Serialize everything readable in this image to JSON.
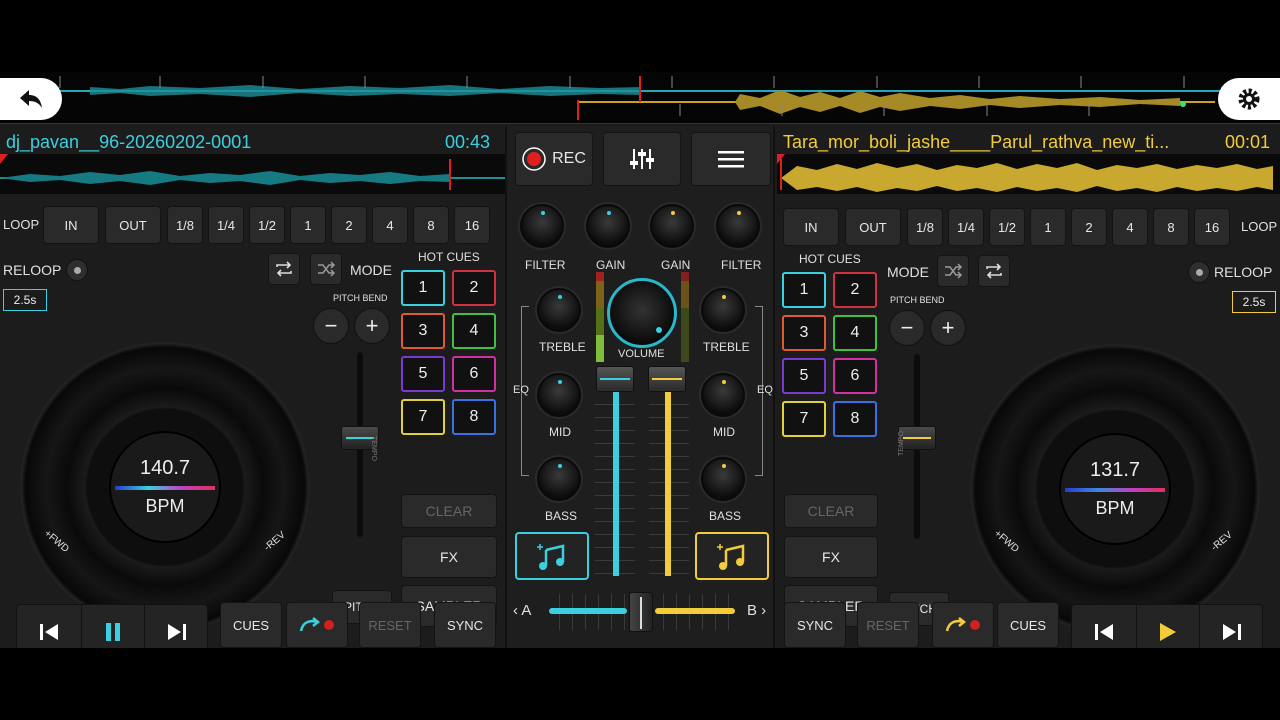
{
  "deckA": {
    "track_title": "dj_pavan__96-20260202-0001",
    "time": "00:43",
    "loop_label": "LOOP",
    "loop_buttons": [
      "IN",
      "OUT",
      "1/8",
      "1/4",
      "1/2",
      "1",
      "2",
      "4",
      "8",
      "16"
    ],
    "reloop": "RELOOP",
    "loop_len": "2.5s",
    "mode": "MODE",
    "pitch_bend": "PITCH BEND",
    "hot_cues": "HOT CUES",
    "cues": [
      "1",
      "2",
      "3",
      "4",
      "5",
      "6",
      "7",
      "8"
    ],
    "clear": "CLEAR",
    "fx": "FX",
    "sampler": "SAMPLER",
    "bpm_value": "140.7",
    "bpm_label": "BPM",
    "fwd": "+FWD",
    "rev": "-REV",
    "tempo": "TEMPO",
    "pitch": "PITCH",
    "cues_btn": "CUES",
    "reset": "RESET",
    "sync": "SYNC",
    "accent": "#3ad0e0"
  },
  "deckB": {
    "track_title": "Tara_mor_boli_jashe____Parul_rathva_new_ti...",
    "time": "00:01",
    "loop_label": "LOOP",
    "loop_buttons": [
      "IN",
      "OUT",
      "1/8",
      "1/4",
      "1/2",
      "1",
      "2",
      "4",
      "8",
      "16"
    ],
    "reloop": "RELOOP",
    "loop_len": "2.5s",
    "mode": "MODE",
    "pitch_bend": "PITCH BEND",
    "hot_cues": "HOT CUES",
    "cues": [
      "1",
      "2",
      "3",
      "4",
      "5",
      "6",
      "7",
      "8"
    ],
    "clear": "CLEAR",
    "fx": "FX",
    "sampler": "SAMPLER",
    "bpm_value": "131.7",
    "bpm_label": "BPM",
    "fwd": "+FWD",
    "rev": "-REV",
    "tempo": "TEMPO",
    "pitch": "PITCH",
    "cues_btn": "CUES",
    "reset": "RESET",
    "sync": "SYNC",
    "accent": "#f2cc3a"
  },
  "mixer": {
    "rec": "REC",
    "filter": "FILTER",
    "gain": "GAIN",
    "treble": "TREBLE",
    "mid": "MID",
    "bass": "BASS",
    "eq": "EQ",
    "volume": "VOLUME",
    "cross_a": "A",
    "cross_b": "B"
  },
  "icons": {
    "back": "back-arrow-icon",
    "settings": "gear-icon",
    "mixer": "sliders-icon",
    "menu": "hamburger-menu-icon"
  }
}
